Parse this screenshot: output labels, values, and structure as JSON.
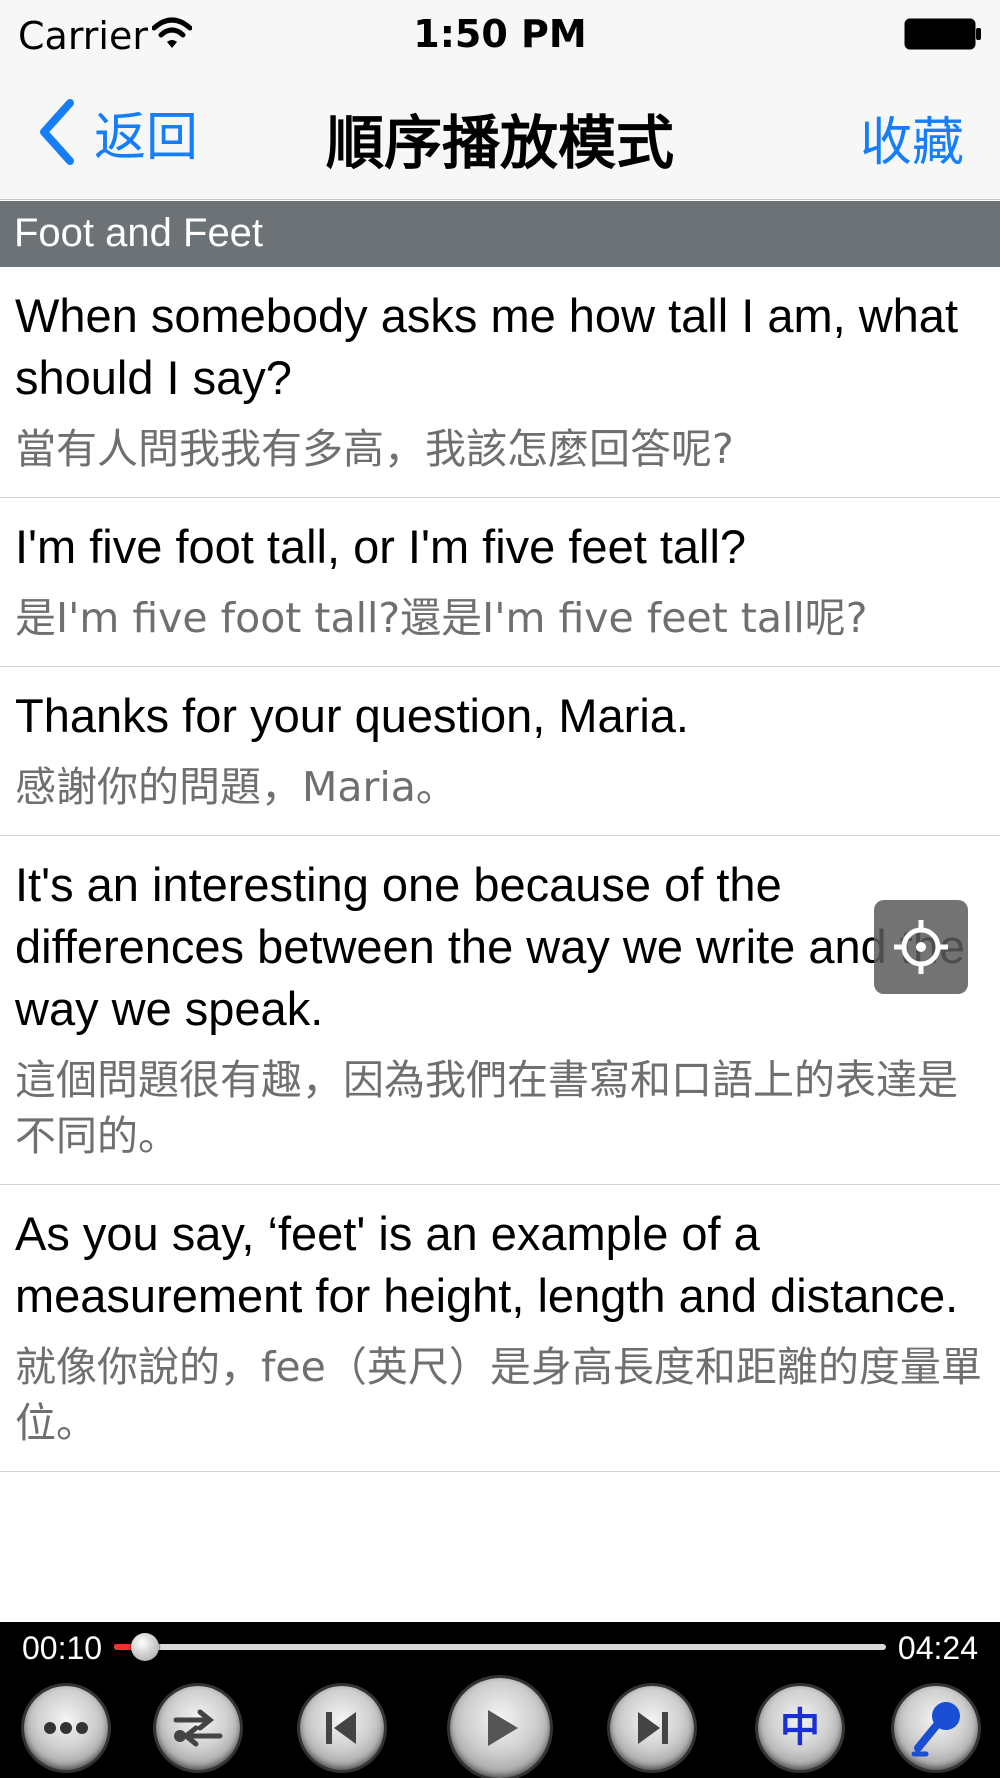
{
  "status_bar": {
    "carrier": "Carrier",
    "time": "1:50 PM"
  },
  "nav": {
    "back_label": "返回",
    "title": "順序播放模式",
    "favorite_label": "收藏",
    "accent_color": "#147efb"
  },
  "section": {
    "title": "Foot and Feet",
    "background_color": "#6c7275"
  },
  "sentences": [
    {
      "en": "When somebody asks me how tall I am, what should I say?",
      "zh": "當有人問我我有多高，我該怎麼回答呢?"
    },
    {
      "en": "I'm five foot tall, or I'm five feet tall?",
      "zh": "是I'm five foot tall?還是I'm five feet tall呢?"
    },
    {
      "en": "Thanks for your question, Maria.",
      "zh": "感謝你的問題，Maria。"
    },
    {
      "en": "It's an interesting one because of the differences between the way we write and the way we speak.",
      "zh": "這個問題很有趣，因為我們在書寫和口語上的表達是不同的。"
    },
    {
      "en": "As you say, ‘feet' is an example of a measurement for height, length and distance.",
      "zh": "就像你說的，fee（英尺）是身高長度和距離的度量單位。"
    }
  ],
  "locate_button": {
    "icon": "crosshair-icon"
  },
  "player": {
    "current_time": "00:10",
    "total_time": "04:24",
    "progress_fraction": 0.04,
    "controls": {
      "more_icon": "ellipsis-icon",
      "repeat_icon": "repeat-shuffle-icon",
      "previous_icon": "skip-previous-icon",
      "play_icon": "play-icon",
      "next_icon": "skip-next-icon",
      "chinese_toggle_label": "中",
      "record_icon": "microphone-icon"
    }
  }
}
